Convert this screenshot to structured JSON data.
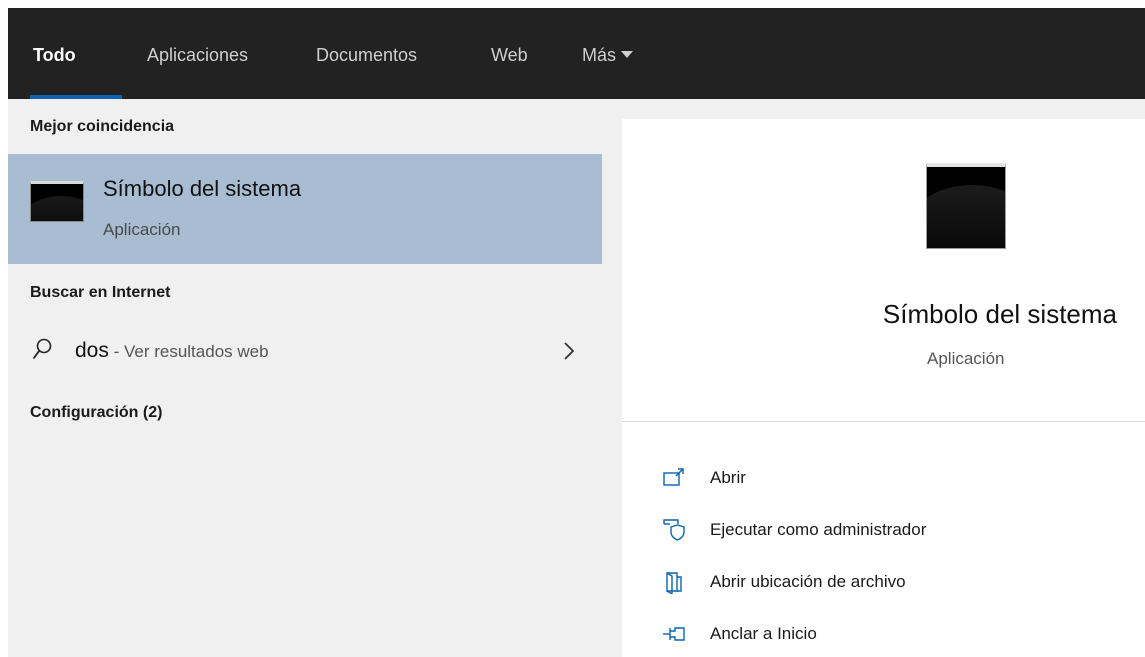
{
  "tabs": {
    "todo": "Todo",
    "apps": "Aplicaciones",
    "docs": "Documentos",
    "web": "Web",
    "more": "Más"
  },
  "left": {
    "best_match_heading": "Mejor coincidencia",
    "best_match": {
      "title": "Símbolo del sistema",
      "subtitle": "Aplicación",
      "icon": "command-prompt-icon"
    },
    "web_heading": "Buscar en Internet",
    "web_result": {
      "query": "dos",
      "separator": " - ",
      "suffix": "Ver resultados web"
    },
    "settings_heading": "Configuración (2)"
  },
  "right": {
    "title": "Símbolo del sistema",
    "subtitle": "Aplicación",
    "actions": [
      {
        "label": "Abrir",
        "icon": "open-icon"
      },
      {
        "label": "Ejecutar como administrador",
        "icon": "run-as-admin-icon"
      },
      {
        "label": "Abrir ubicación de archivo",
        "icon": "file-location-icon"
      },
      {
        "label": "Anclar a Inicio",
        "icon": "pin-icon"
      }
    ]
  },
  "colors": {
    "tabbar_bg": "#222222",
    "accent_underline": "#0a64b4",
    "selected_row_bg": "#a8bcd2",
    "panel_bg": "#f0f0f0"
  }
}
